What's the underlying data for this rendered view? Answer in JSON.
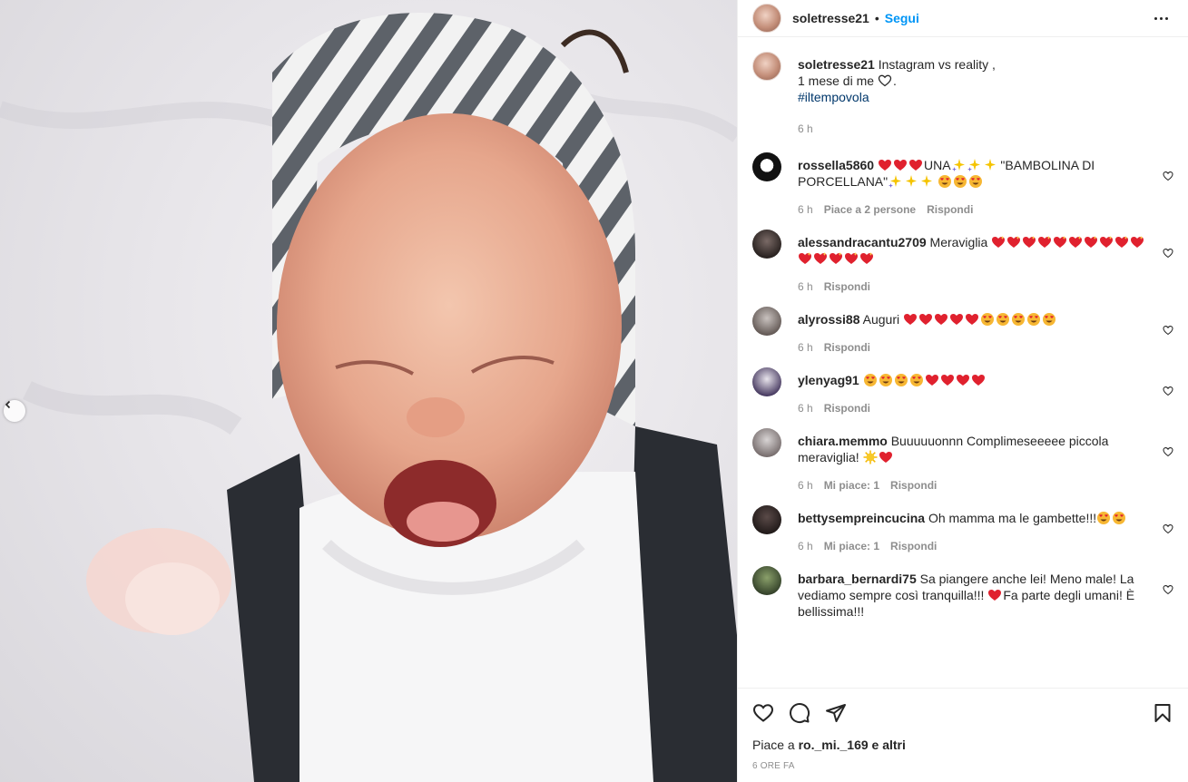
{
  "post": {
    "username": "soletresse21",
    "follow_label": "Segui",
    "separator": "•"
  },
  "caption": {
    "username": "soletresse21",
    "line1": "Instagram vs reality ,",
    "line2": "1 mese di me",
    "line2_end": ".",
    "hashtag": "#iltempovola",
    "time": "6 h"
  },
  "comments": [
    {
      "username": "rossella5860",
      "text_a": "UNA",
      "text_b": "\"BAMBOLINA DI PORCELLANA\"",
      "time": "6 h",
      "likes": "Piace a 2 persone",
      "reply": "Rispondi"
    },
    {
      "username": "alessandracantu2709",
      "text_a": "Meraviglia",
      "time": "6 h",
      "reply": "Rispondi"
    },
    {
      "username": "alyrossi88",
      "text_a": "Auguri",
      "time": "6 h",
      "reply": "Rispondi"
    },
    {
      "username": "ylenyag91",
      "time": "6 h",
      "reply": "Rispondi"
    },
    {
      "username": "chiara.memmo",
      "text_a": "Buuuuuonnn Complimeseeeee piccola meraviglia!",
      "time": "6 h",
      "likes": "Mi piace: 1",
      "reply": "Rispondi"
    },
    {
      "username": "bettysempreincucina",
      "text_a": "Oh mamma ma le gambette!!!",
      "time": "6 h",
      "likes": "Mi piace: 1",
      "reply": "Rispondi"
    },
    {
      "username": "barbara_bernardi75",
      "text_a": "Sa piangere anche lei! Meno male! La vediamo sempre così tranquilla!!!",
      "text_b": "Fa parte degli umani! È bellissima!!!"
    }
  ],
  "footer": {
    "likes_prefix": "Piace a",
    "likes_user": "ro._mi._169",
    "likes_suffix": "e altri",
    "timestamp": "6 ORE FA"
  },
  "icons": {
    "heart": "heart-icon",
    "comment": "comment-icon",
    "share": "share-icon",
    "save": "bookmark-icon",
    "more": "more-icon",
    "prev": "chevron-left-icon"
  },
  "colors": {
    "link": "#0095f6",
    "hashtag": "#00376b",
    "muted": "#8e8e8e",
    "heart_red": "#e0212e"
  }
}
